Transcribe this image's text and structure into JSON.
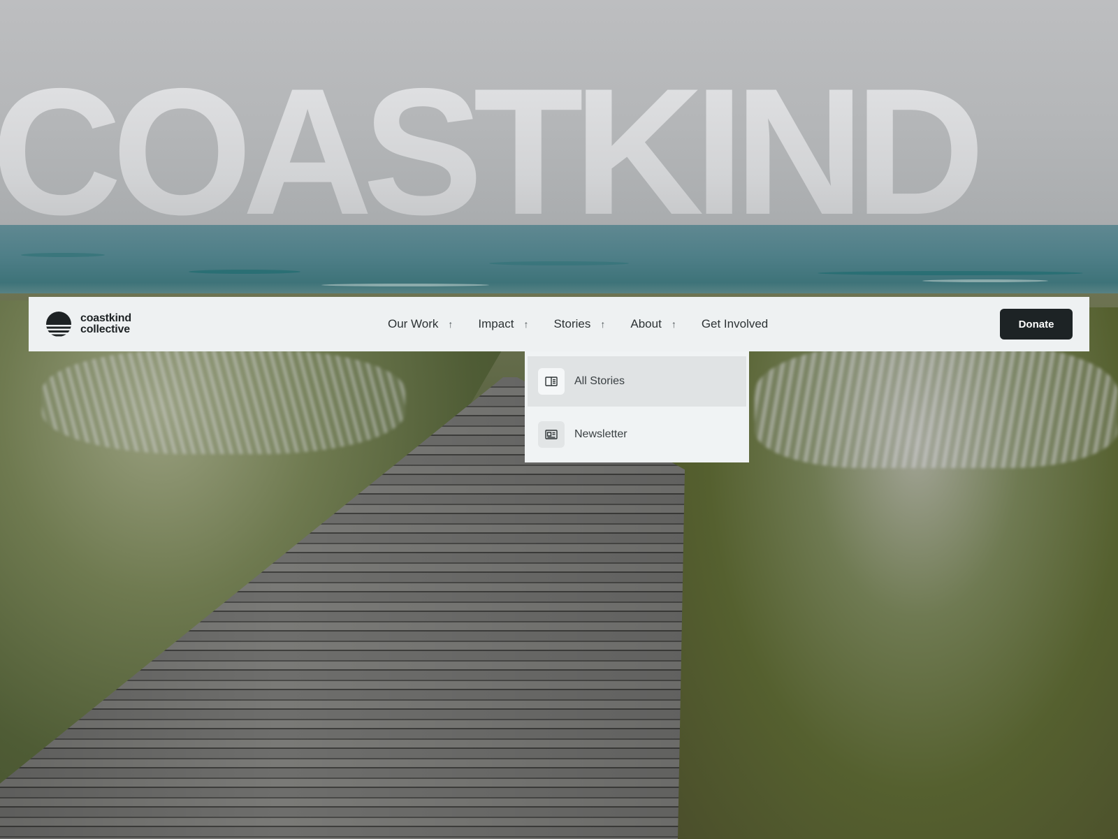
{
  "hero": {
    "word": "COASTKIND"
  },
  "brand": {
    "line1": "coastkind",
    "line2": "collective"
  },
  "nav": {
    "items": [
      {
        "label": "Our Work",
        "arrow": "↑"
      },
      {
        "label": "Impact",
        "arrow": "↑"
      },
      {
        "label": "Stories",
        "arrow": "↑"
      },
      {
        "label": "About",
        "arrow": "↑"
      },
      {
        "label": "Get Involved"
      }
    ],
    "cta": "Donate"
  },
  "dropdown": {
    "items": [
      {
        "label": "All Stories",
        "icon": "book-open-icon",
        "active": true
      },
      {
        "label": "Newsletter",
        "icon": "newspaper-icon",
        "active": false
      }
    ]
  },
  "colors": {
    "nav_bg": "#eef1f2",
    "cta_bg": "#1d2325",
    "cta_text": "#ffffff",
    "dropdown_active": "#e0e3e4"
  }
}
